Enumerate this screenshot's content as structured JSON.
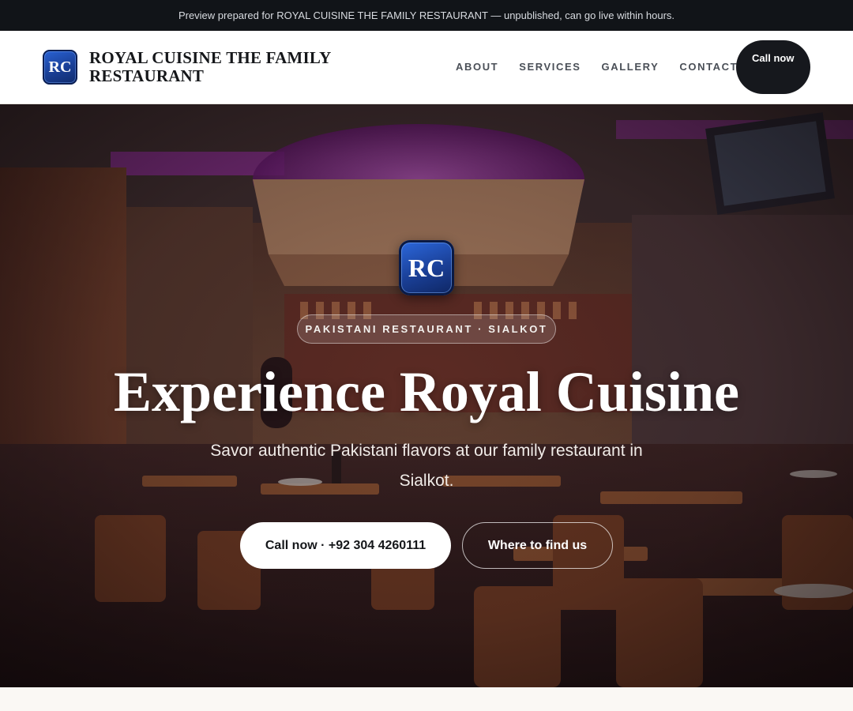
{
  "banner": {
    "text": "Preview prepared for ROYAL CUISINE THE FAMILY RESTAURANT — unpublished, can go live within hours."
  },
  "header": {
    "logo_initials": "RC",
    "brand_name": "ROYAL CUISINE THE FAMILY RESTAURANT",
    "nav": [
      "ABOUT",
      "SERVICES",
      "GALLERY",
      "CONTACT"
    ],
    "cta_label": "Call now"
  },
  "hero": {
    "logo_initials": "RC",
    "tag": "PAKISTANI RESTAURANT · SIALKOT",
    "title": "Experience Royal Cuisine",
    "subtitle": "Savor authentic Pakistani flavors at our family restaurant in Sialkot.",
    "primary_button": "Call now · +92 304 4260111",
    "secondary_button": "Where to find us",
    "background": "restaurant-interior-photo"
  },
  "colors": {
    "topbar": "#111418",
    "header_bg": "#ffffff",
    "cta_dark": "#16181d",
    "badge_blue": "#1a3f96",
    "neon_purple": "#c23ad6"
  }
}
